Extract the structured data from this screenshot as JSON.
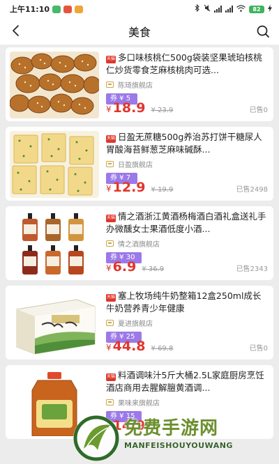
{
  "status_bar": {
    "time": "上午11:10",
    "app_icon_colors": [
      "#48b86a",
      "#e7543d",
      "#f0a537"
    ],
    "battery": "82"
  },
  "header": {
    "title": "美食",
    "back_icon": "chevron-left-icon",
    "search_icon": "search-icon"
  },
  "products": [
    {
      "tag": "天猫",
      "name": "多口味核桃仁500g袋装坚果琥珀核桃仁炒货零食芝麻核桃肉可选...",
      "shop": "陈琦旗舰店",
      "coupon": "券 ¥ 5",
      "currency": "¥",
      "price": "18.9",
      "original_price": "¥ 23.9",
      "sold": "已售0"
    },
    {
      "tag": "天猫",
      "name": "日盈无蔗糖500g养治苏打饼干糖尿人胃酸海苔鲜葱芝麻味碱酥...",
      "shop": "日盈旗舰店",
      "coupon": "券 ¥ 7",
      "currency": "¥",
      "price": "12.9",
      "original_price": "¥ 19.9",
      "sold": "已售2498"
    },
    {
      "tag": "天猫",
      "name": "情之酒浙江黄酒杨梅酒白酒礼盒送礼手办微醺女士果酒低度小酒...",
      "shop": "情之酒旗舰店",
      "coupon": "券 ¥ 30",
      "currency": "¥",
      "price": "6.9",
      "original_price": "¥ 36.9",
      "sold": "已售2343"
    },
    {
      "tag": "天猫",
      "name": "塞上牧场纯牛奶整箱12盒250ml成长牛奶营养青少年健康",
      "shop": "夏进旗舰店",
      "coupon": "券 ¥ 25",
      "currency": "¥",
      "price": "44.8",
      "original_price": "¥ 69.8",
      "sold": "已售0"
    },
    {
      "tag": "天猫",
      "name": "料酒调味汁5斤大桶2.5L家庭厨房烹饪酒店商用去腥解膻黄酒调...",
      "shop": "果味来旗舰店",
      "coupon": "券 ¥ 15",
      "currency": "¥",
      "price": "14.9",
      "original_price": "",
      "sold": ""
    }
  ],
  "watermark": {
    "title": "免费手游网",
    "subtitle": "MANFEISHOUYOUWANG"
  }
}
